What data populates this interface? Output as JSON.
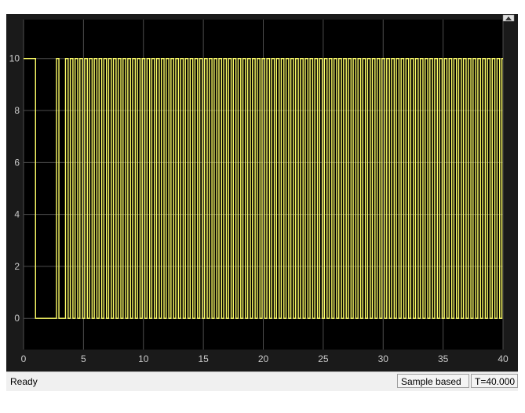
{
  "status": {
    "state": "Ready",
    "mode": "Sample based",
    "time": "T=40.000"
  },
  "colors": {
    "background": "#1a1a1a",
    "plot_background": "#000000",
    "grid": "#4d4d4d",
    "signal": "#ffff66",
    "tick_labels": "#cccccc"
  },
  "chart_data": {
    "type": "line",
    "title": "",
    "xlabel": "",
    "ylabel": "",
    "xlim": [
      0,
      40
    ],
    "ylim": [
      -1.2,
      11.5
    ],
    "x_ticks": [
      "0",
      "5",
      "10",
      "15",
      "20",
      "25",
      "30",
      "35",
      "40"
    ],
    "y_ticks": [
      "0",
      "2",
      "4",
      "6",
      "8",
      "10"
    ],
    "grid": true,
    "signal": {
      "high": 10,
      "low": 0,
      "initial_high_until": 1.0,
      "second_pulse": [
        2.75,
        2.95
      ],
      "periodic_start": 3.5,
      "period": 0.4,
      "duty": 0.55,
      "end": 40
    }
  }
}
